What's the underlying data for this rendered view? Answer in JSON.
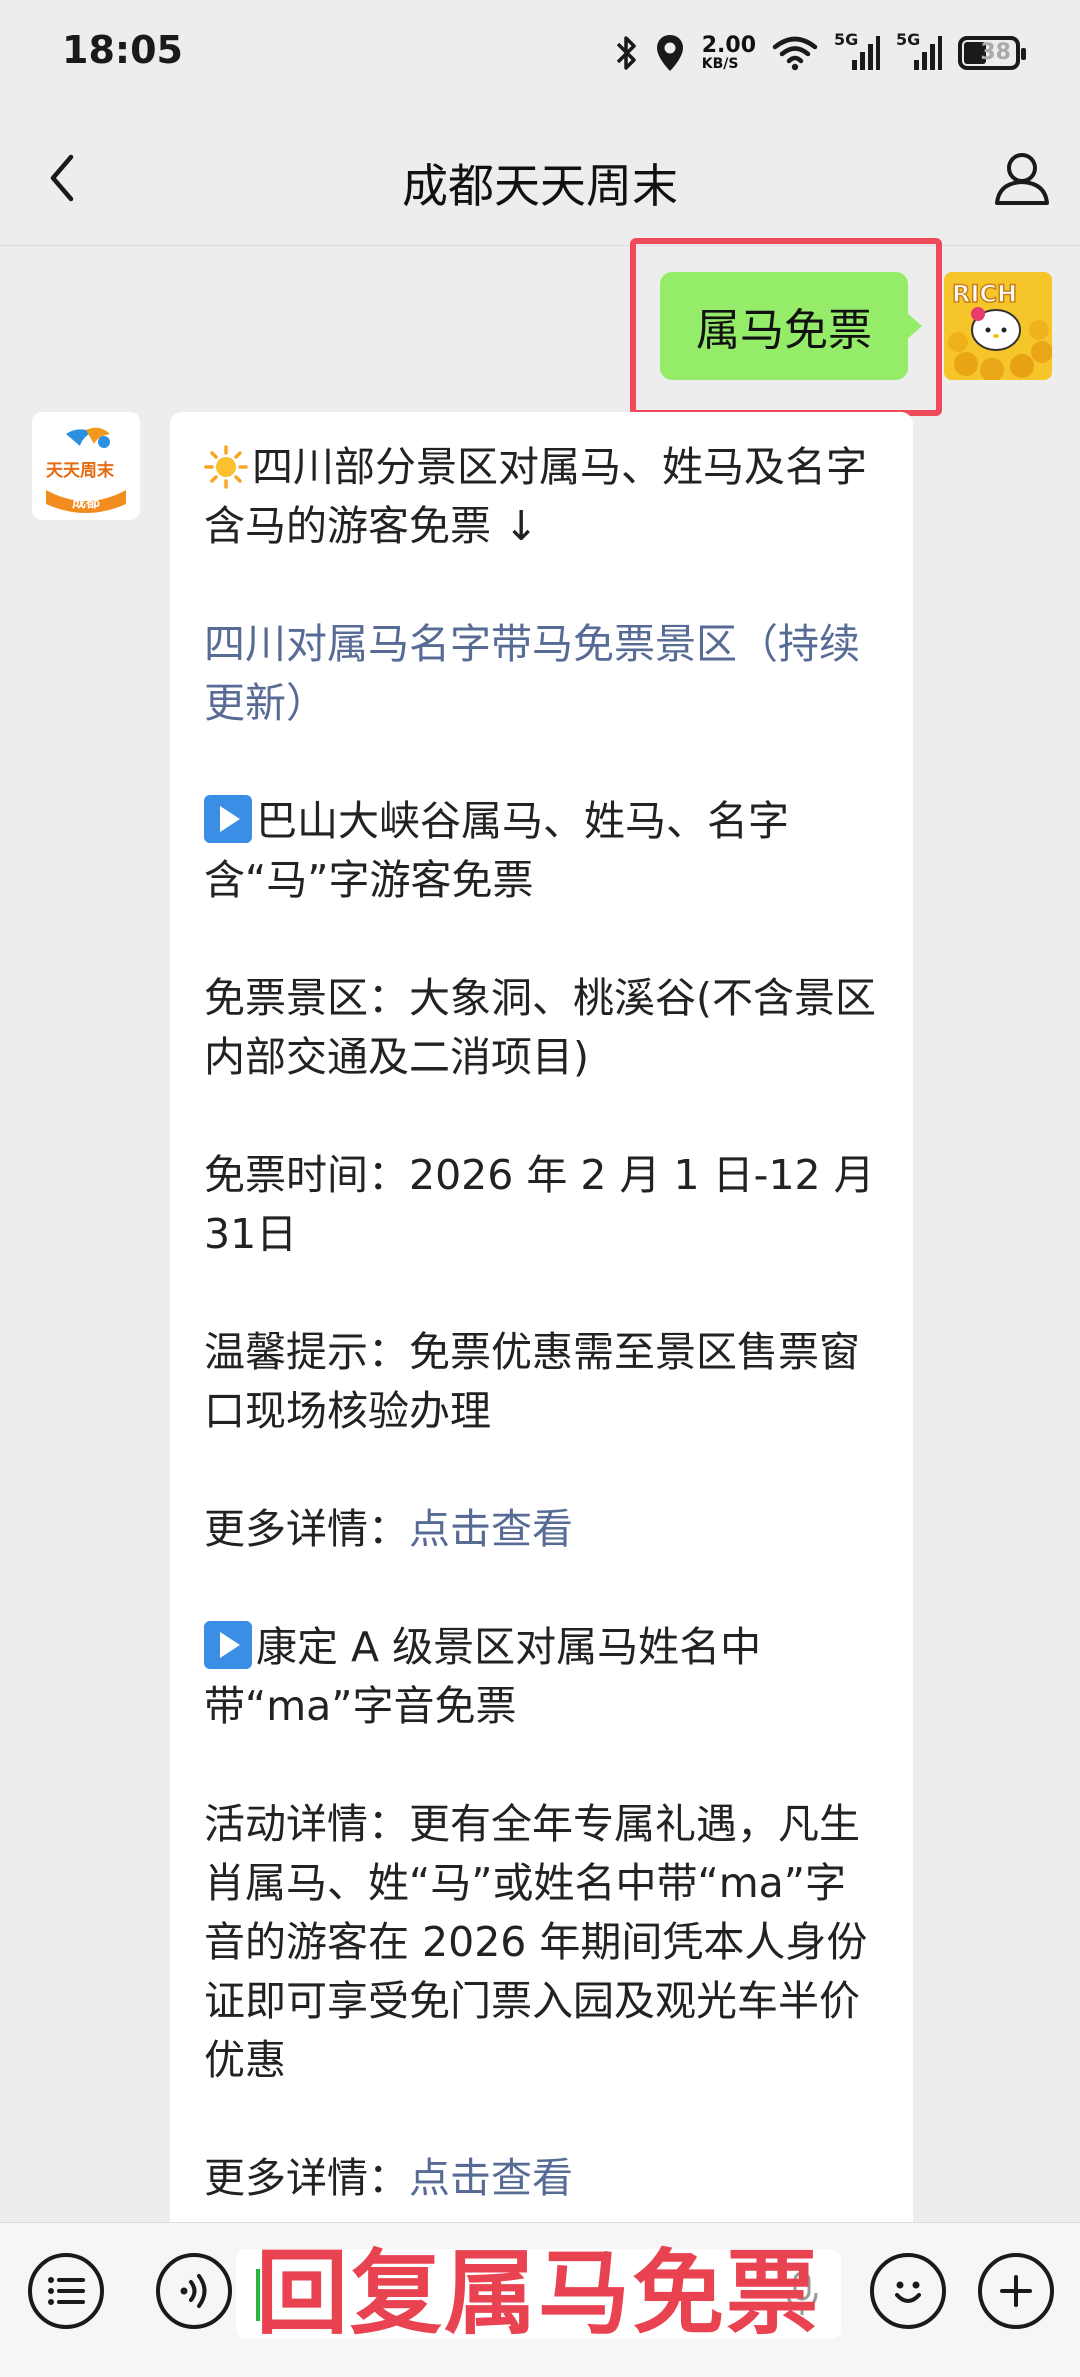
{
  "status_bar": {
    "time": "18:05",
    "net_speed_value": "2.00",
    "net_speed_unit": "KB/S",
    "signal_1": "5G",
    "signal_2": "5G",
    "battery": "38"
  },
  "header": {
    "title": "成都天天周末"
  },
  "sent_message": {
    "text": "属马免票"
  },
  "bot": {
    "avatar_text_top": "天天周末",
    "avatar_text_bottom": "成都"
  },
  "received_message": {
    "intro": "四川部分景区对属马、姓马及名字含马的游客免票 ↓",
    "link_title": "四川对属马名字带马免票景区（持续更新）",
    "section1_title": "巴山大峡谷属马、姓马、名字含“马”字游客免票",
    "section1_scenic": "免票景区：大象洞、桃溪谷(不含景区内部交通及二消项目)",
    "section1_time": "免票时间：2026 年 2 月 1 日-12 月 31日",
    "section1_tip": "温馨提示：免票优惠需至景区售票窗口现场核验办理",
    "more_label_1": "更多详情：",
    "more_link_1": "点击查看",
    "section2_title": "康定 A 级景区对属马姓名中带“ma”字音免票",
    "section2_detail": "活动详情：更有全年专属礼遇，凡生肖属马、姓“马”或姓名中带“ma”字音的游客在 2026 年期间凭本人身份证即可享受免门票入园及观光车半价优惠",
    "more_label_2": "更多详情：",
    "more_link_2": "点击查看"
  },
  "bottom_bar": {
    "overlay_text": "回复属马免票"
  },
  "colors": {
    "sent_bubble": "#95ec69",
    "highlight_border": "#ef4b5b",
    "link": "#576b95",
    "overlay_text": "#e94250"
  }
}
